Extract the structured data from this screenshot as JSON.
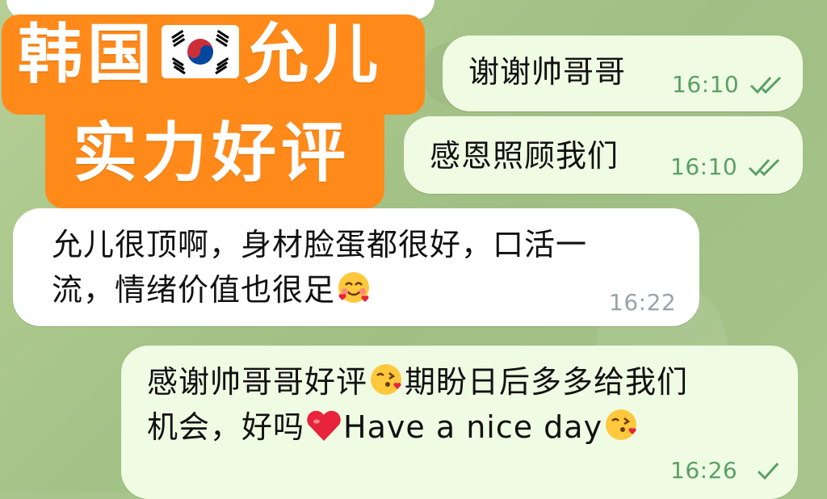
{
  "promo": {
    "line1_a": "韩国",
    "line1_b": "允儿",
    "line2": "实力好评",
    "flag_icon": "south-korea-flag"
  },
  "colors": {
    "promo_bg": "#ff8a1a",
    "incoming_bubble": "#ffffff",
    "outgoing_bubble": "#effbe3",
    "outgoing_time": "#5aa064",
    "chat_bg": "#a9c58d"
  },
  "messages": [
    {
      "id": "m1",
      "direction": "outgoing",
      "text": "谢谢帅哥哥",
      "time": "16:10",
      "status": "read"
    },
    {
      "id": "m2",
      "direction": "outgoing",
      "text": "感恩照顾我们",
      "time": "16:10",
      "status": "read"
    },
    {
      "id": "m3",
      "direction": "incoming",
      "line1": "允儿很顶啊，身材脸蛋都很好，口活一",
      "line2": "流，情绪价值也很足",
      "emoji": "smiling-face-with-hearts",
      "time": "16:22"
    },
    {
      "id": "m4",
      "direction": "outgoing",
      "line1_a": "感谢帅哥哥好评",
      "line1_emoji": "face-blowing-kiss",
      "line1_b": "期盼日后多多给我们",
      "line2_a": "机会，好吗",
      "line2_emoji1": "red-heart",
      "line2_b": "Have a nice day",
      "line2_emoji2": "face-blowing-kiss",
      "time": "16:26",
      "status": "sent"
    }
  ]
}
